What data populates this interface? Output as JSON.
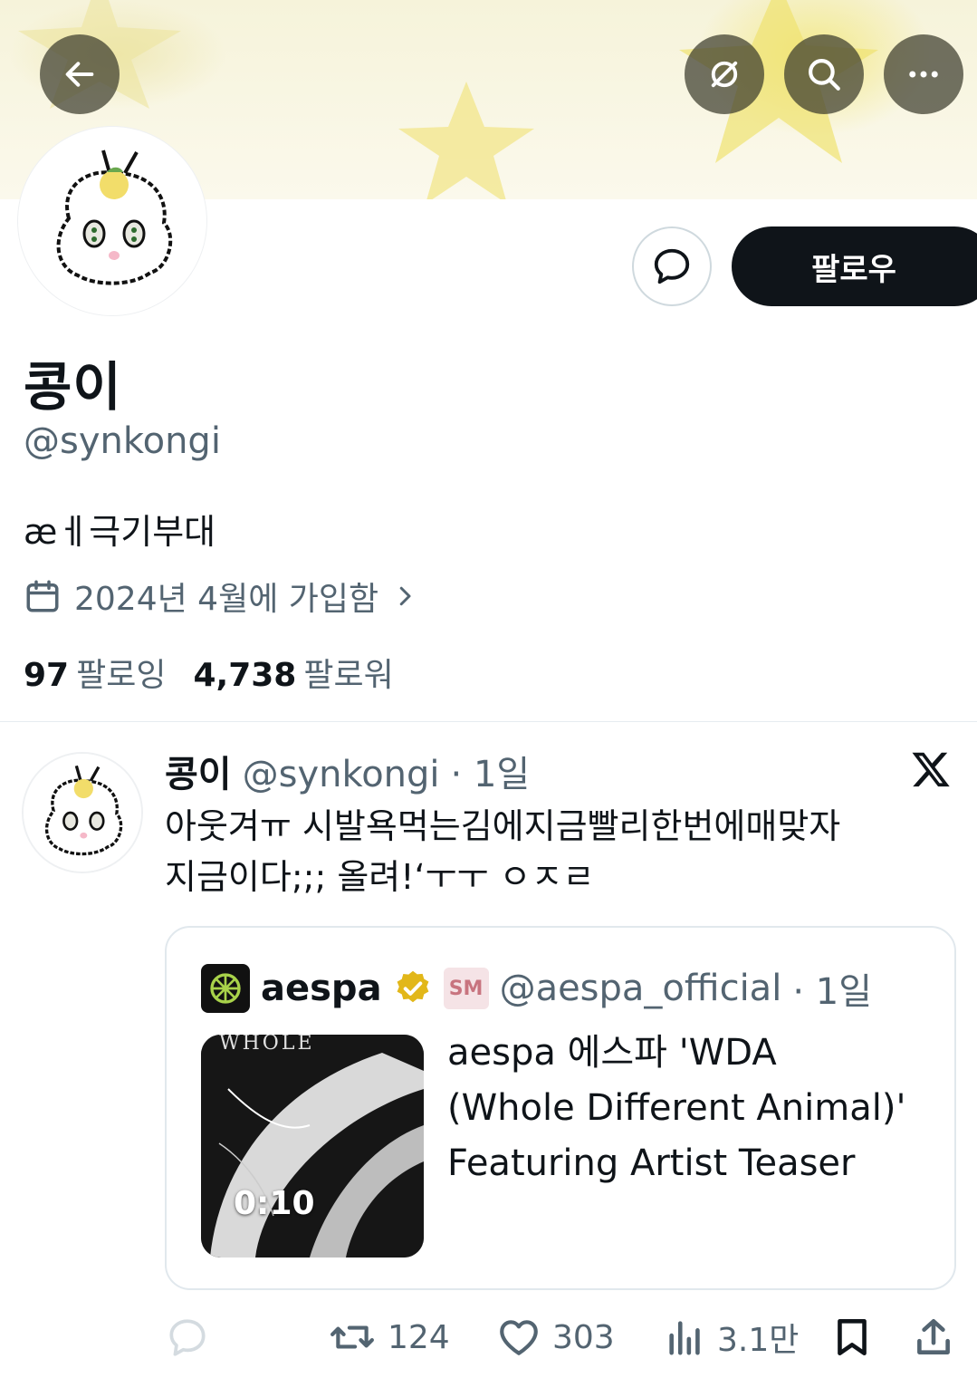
{
  "header": {
    "back_icon": "arrow-left-icon",
    "actions": [
      "hide-link-icon",
      "search-icon",
      "more-icon"
    ]
  },
  "profile": {
    "display_name": "콩이",
    "handle": "@synkongi",
    "bio": "æㅔ극기부대",
    "joined": "2024년 4월에 가입함",
    "follow_button": "팔로우",
    "following_count": "97",
    "following_label": "팔로잉",
    "followers_count": "4,738",
    "followers_label": "팔로워"
  },
  "tweet": {
    "name": "콩이",
    "handle": "@synkongi",
    "time": "· 1일",
    "lines": [
      "아웃겨ㅠ 시발욕먹는김에지금빨리한번에매맞자",
      "지금이다;;; 올려!‘ㅜㅜ ㅇㅈㄹ"
    ],
    "quote": {
      "name": "aespa",
      "handle": "@aespa_official",
      "time": "· 1일",
      "badge": "SM",
      "duration": "0:10",
      "title_lines": [
        "aespa 에스파 'WDA",
        "(Whole Different Animal)'",
        "Featuring Artist Teaser"
      ]
    },
    "actions": {
      "reposts": "124",
      "likes": "303",
      "views": "3.1만"
    }
  },
  "colors": {
    "text_primary": "#0f1419",
    "text_secondary": "#536471",
    "verified_gold": "#e2b719",
    "banner_yellow": "#f3e98a"
  }
}
